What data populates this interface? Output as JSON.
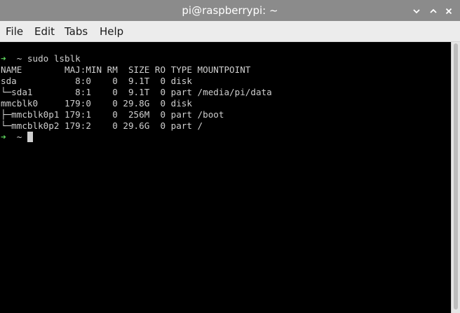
{
  "window": {
    "title": "pi@raspberrypi: ~",
    "minimize_icon": "chevron-down-icon",
    "maximize_icon": "chevron-up-icon",
    "close_icon": "close-icon"
  },
  "menubar": {
    "items": [
      "File",
      "Edit",
      "Tabs",
      "Help"
    ]
  },
  "terminal": {
    "prompt_symbol": "➜",
    "command_line": "  ~ sudo lsblk",
    "output": [
      "NAME        MAJ:MIN RM  SIZE RO TYPE MOUNTPOINT",
      "sda           8:0    0  9.1T  0 disk",
      "└─sda1        8:1    0  9.1T  0 part /media/pi/data",
      "mmcblk0     179:0    0 29.8G  0 disk",
      "├─mmcblk0p1 179:1    0  256M  0 part /boot",
      "└─mmcblk0p2 179:2    0 29.6G  0 part /"
    ],
    "current_prompt": "  ~ ",
    "colors": {
      "background": "#000000",
      "text": "#cfcfcf",
      "prompt_arrow": "#5fd75f"
    }
  }
}
